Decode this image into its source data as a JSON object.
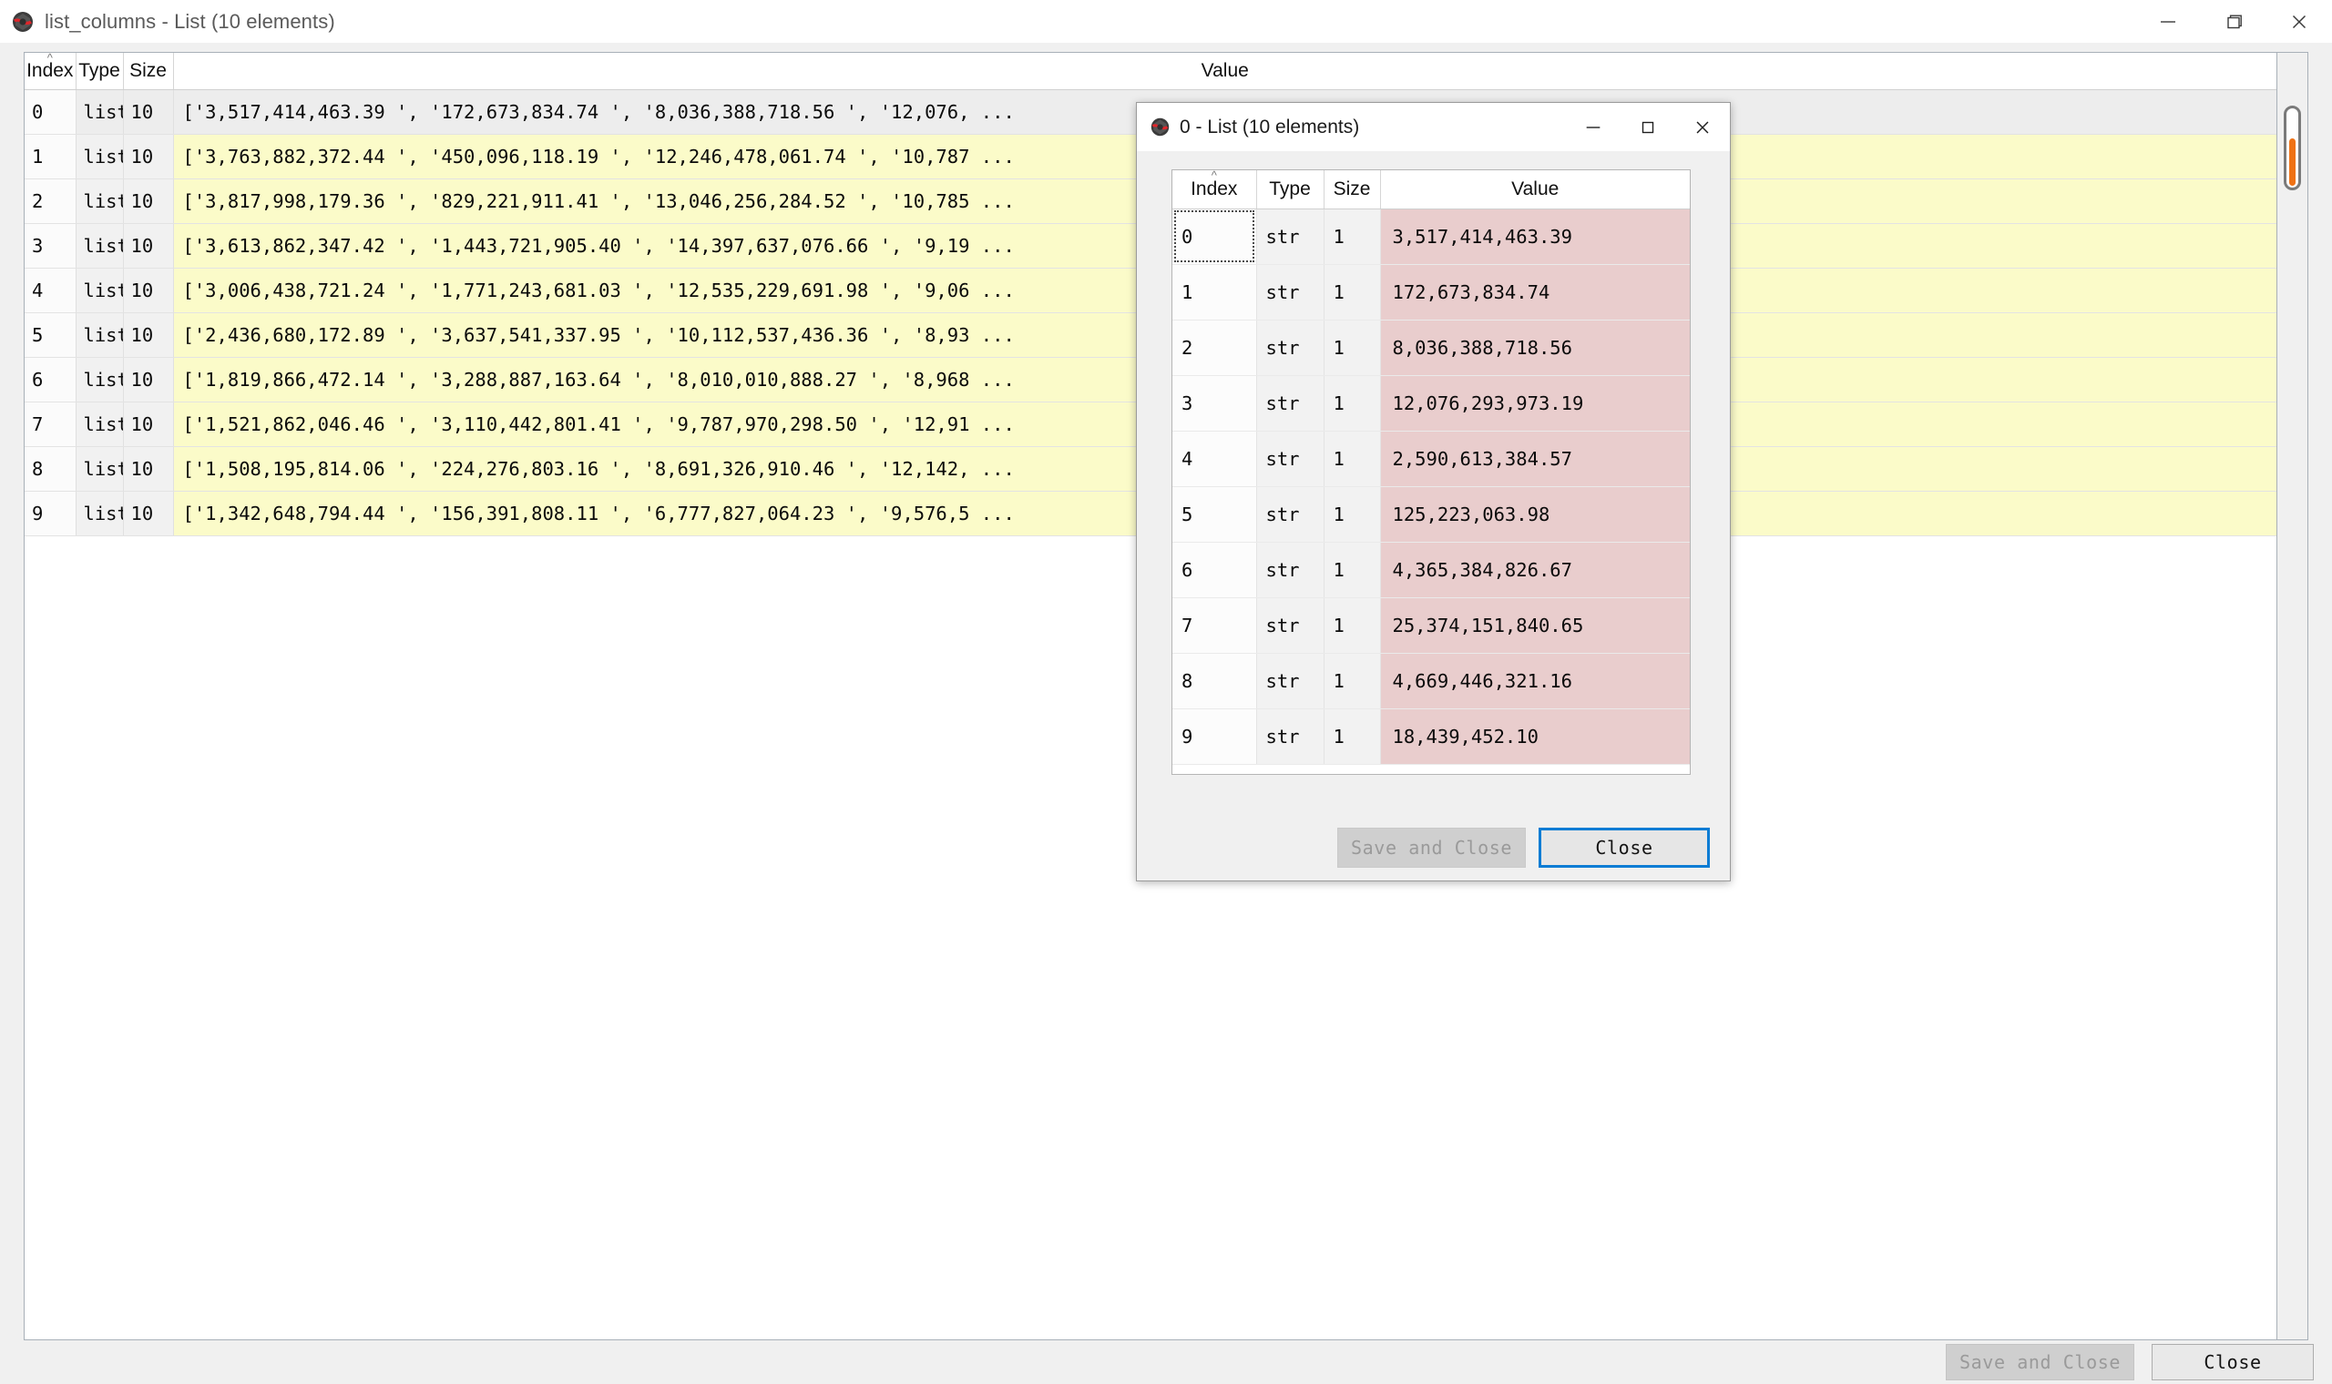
{
  "main_window": {
    "title": "list_columns - List (10 elements)",
    "icon": "python-debug-bug-icon",
    "window_controls": {
      "minimize": "minimize-icon",
      "maximize": "maximize-icon",
      "close": "close-icon"
    },
    "table": {
      "columns": [
        "Index",
        "Type",
        "Size",
        "Value"
      ],
      "sort_indicator": "^",
      "sorted_column": "Index",
      "rows": [
        {
          "index": "0",
          "type": "list",
          "size": "10",
          "value": "['3,517,414,463.39 ', '172,673,834.74 ', '8,036,388,718.56 ', '12,076, ..."
        },
        {
          "index": "1",
          "type": "list",
          "size": "10",
          "value": "['3,763,882,372.44 ', '450,096,118.19 ', '12,246,478,061.74 ', '10,787 ..."
        },
        {
          "index": "2",
          "type": "list",
          "size": "10",
          "value": "['3,817,998,179.36 ', '829,221,911.41 ', '13,046,256,284.52 ', '10,785 ..."
        },
        {
          "index": "3",
          "type": "list",
          "size": "10",
          "value": "['3,613,862,347.42 ', '1,443,721,905.40 ', '14,397,637,076.66 ', '9,19 ..."
        },
        {
          "index": "4",
          "type": "list",
          "size": "10",
          "value": "['3,006,438,721.24 ', '1,771,243,681.03 ', '12,535,229,691.98 ', '9,06 ..."
        },
        {
          "index": "5",
          "type": "list",
          "size": "10",
          "value": "['2,436,680,172.89 ', '3,637,541,337.95 ', '10,112,537,436.36 ', '8,93 ..."
        },
        {
          "index": "6",
          "type": "list",
          "size": "10",
          "value": "['1,819,866,472.14 ', '3,288,887,163.64 ', '8,010,010,888.27 ', '8,968 ..."
        },
        {
          "index": "7",
          "type": "list",
          "size": "10",
          "value": "['1,521,862,046.46 ', '3,110,442,801.41 ', '9,787,970,298.50 ', '12,91 ..."
        },
        {
          "index": "8",
          "type": "list",
          "size": "10",
          "value": "['1,508,195,814.06 ', '224,276,803.16 ', '8,691,326,910.46 ', '12,142, ..."
        },
        {
          "index": "9",
          "type": "list",
          "size": "10",
          "value": "['1,342,648,794.44 ', '156,391,808.11 ', '6,777,827,064.23 ', '9,576,5 ..."
        }
      ],
      "selected_row_index": "0"
    },
    "scrollbar": {
      "name": "vertical-scrollbar",
      "thumb_color": "#ef7215"
    },
    "footer": {
      "save_and_close_label": "Save and Close",
      "save_and_close_enabled": false,
      "close_label": "Close"
    }
  },
  "dialog": {
    "title": "0 - List (10 elements)",
    "icon": "python-debug-bug-icon",
    "window_controls": {
      "minimize": "minimize-icon",
      "maximize": "maximize-icon",
      "close": "close-icon"
    },
    "table": {
      "columns": [
        "Index",
        "Type",
        "Size",
        "Value"
      ],
      "sort_indicator": "^",
      "sorted_column": "Index",
      "focused_cell": "0",
      "rows": [
        {
          "index": "0",
          "type": "str",
          "size": "1",
          "value": "3,517,414,463.39"
        },
        {
          "index": "1",
          "type": "str",
          "size": "1",
          "value": "172,673,834.74"
        },
        {
          "index": "2",
          "type": "str",
          "size": "1",
          "value": "8,036,388,718.56"
        },
        {
          "index": "3",
          "type": "str",
          "size": "1",
          "value": "12,076,293,973.19"
        },
        {
          "index": "4",
          "type": "str",
          "size": "1",
          "value": "2,590,613,384.57"
        },
        {
          "index": "5",
          "type": "str",
          "size": "1",
          "value": "125,223,063.98"
        },
        {
          "index": "6",
          "type": "str",
          "size": "1",
          "value": "4,365,384,826.67"
        },
        {
          "index": "7",
          "type": "str",
          "size": "1",
          "value": "25,374,151,840.65"
        },
        {
          "index": "8",
          "type": "str",
          "size": "1",
          "value": "4,669,446,321.16"
        },
        {
          "index": "9",
          "type": "str",
          "size": "1",
          "value": "18,439,452.10"
        }
      ]
    },
    "footer": {
      "save_and_close_label": "Save and Close",
      "save_and_close_enabled": false,
      "close_label": "Close",
      "close_focused": true
    }
  },
  "colors": {
    "value_column_main": "#fbfbc9",
    "value_column_dialog": "#e9cdcd",
    "scrollbar_thumb": "#ef7215",
    "focus_border": "#0a7cd4",
    "window_bg": "#f0f0f0"
  }
}
